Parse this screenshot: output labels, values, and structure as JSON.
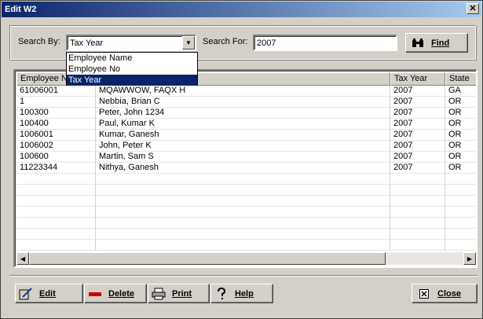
{
  "window": {
    "title": "Edit W2",
    "close_glyph": "✕"
  },
  "search": {
    "by_label": "Search By:",
    "by_value": "Tax Year",
    "options": [
      "Employee Name",
      "Employee No",
      "Tax Year"
    ],
    "selected_option_index": 2,
    "for_label": "Search For:",
    "for_value": "2007",
    "find_label": "Find"
  },
  "grid": {
    "columns": [
      "Employee No",
      "",
      "Tax Year",
      "State"
    ],
    "rows": [
      [
        "61006001",
        "MQAWWOW, FAQX H",
        "2007",
        "GA"
      ],
      [
        "1",
        "Nebbia, Brian C",
        "2007",
        "OR"
      ],
      [
        "100300",
        "Peter, John 1234",
        "2007",
        "OR"
      ],
      [
        "100400",
        "Paul, Kumar K",
        "2007",
        "OR"
      ],
      [
        "1006001",
        "Kumar, Ganesh",
        "2007",
        "OR"
      ],
      [
        "1006002",
        "John, Peter K",
        "2007",
        "OR"
      ],
      [
        "100600",
        "Martin, Sam S",
        "2007",
        "OR"
      ],
      [
        "11223344",
        "Nithya, Ganesh",
        "2007",
        "OR"
      ]
    ]
  },
  "buttons": {
    "edit": "Edit",
    "delete": "Delete",
    "print": "Print",
    "help": "Help",
    "close": "Close"
  },
  "icons": {
    "find": "binoculars-icon",
    "edit": "pencil-icon",
    "delete": "red-bar-icon",
    "print": "printer-icon",
    "help": "question-icon",
    "close": "x-box-icon"
  },
  "colors": {
    "titlebar": "#0a246a",
    "selection": "#0a246a",
    "delete_icon": "#cc0000"
  }
}
